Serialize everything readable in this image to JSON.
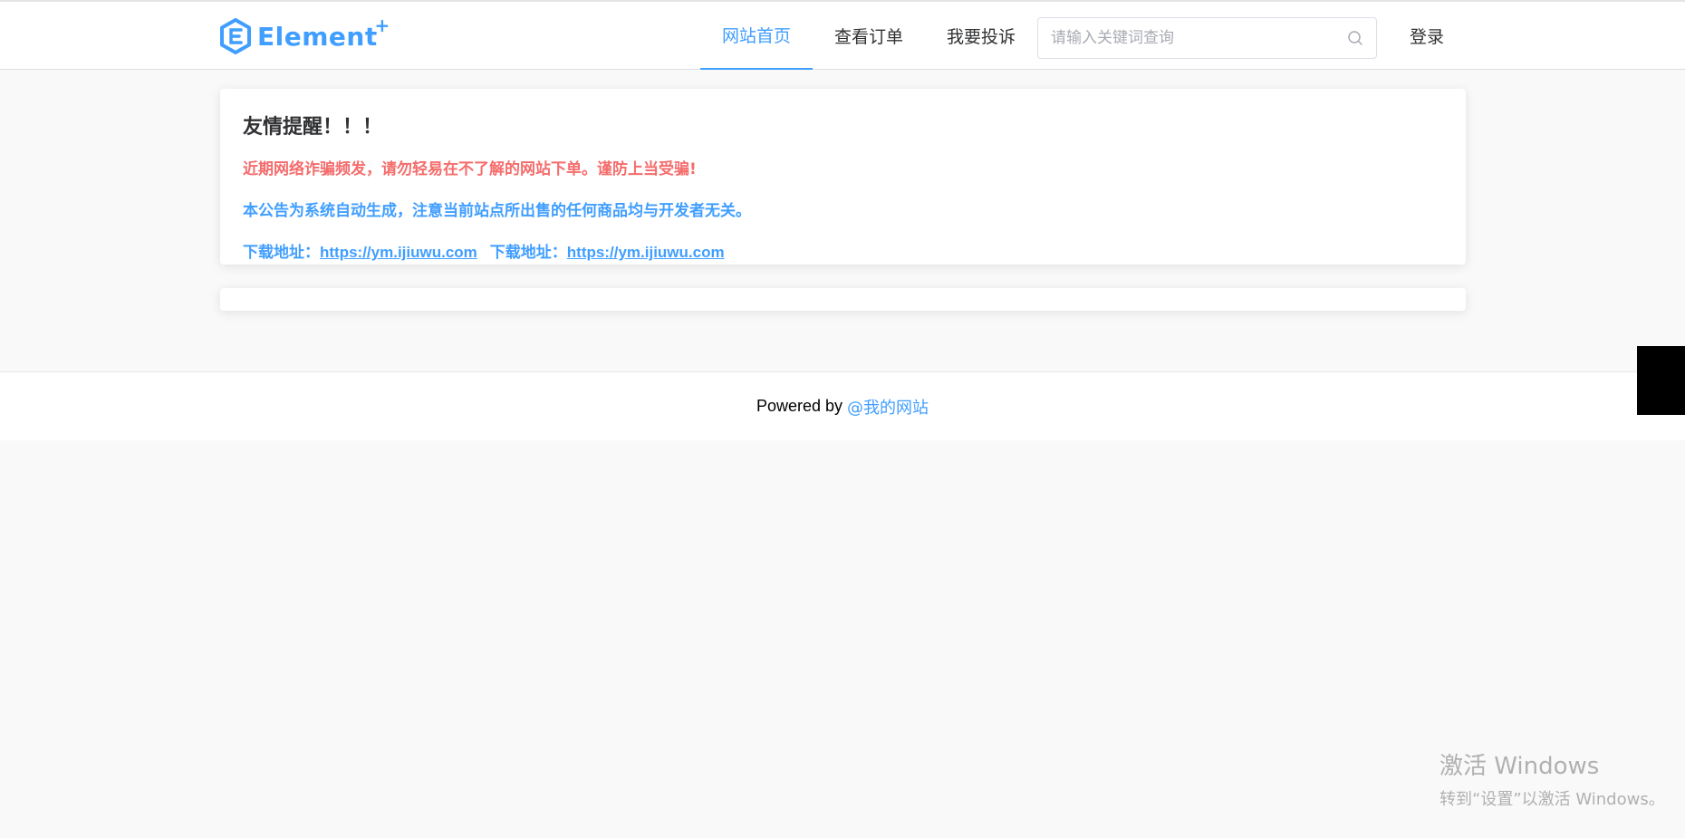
{
  "brand": {
    "logo_text": "Element",
    "logo_suffix": "+",
    "color": "#409eff"
  },
  "nav": {
    "items": [
      {
        "label": "网站首页",
        "active": true
      },
      {
        "label": "查看订单",
        "active": false
      },
      {
        "label": "我要投诉",
        "active": false
      }
    ]
  },
  "search": {
    "placeholder": "请输入关键词查询",
    "value": "",
    "icon": "search-icon"
  },
  "login_label": "登录",
  "notice": {
    "title": "友情提醒！！！",
    "warning": "近期网络诈骗频发，请勿轻易在不了解的网站下单。谨防上当受骗!",
    "info": "本公告为系统自动生成，注意当前站点所出售的任何商品均与开发者无关。",
    "downloads": [
      {
        "label": "下载地址：",
        "url": "https://ym.ijiuwu.com"
      },
      {
        "label": "下载地址：",
        "url": "https://ym.ijiuwu.com"
      }
    ],
    "colors": {
      "warning": "#f56c6c",
      "info": "#409eff"
    }
  },
  "footer": {
    "prefix": "Powered by",
    "link": "@我的网站"
  },
  "watermark": {
    "line1": "激活 Windows",
    "line2": "转到“设置”以激活 Windows。"
  }
}
